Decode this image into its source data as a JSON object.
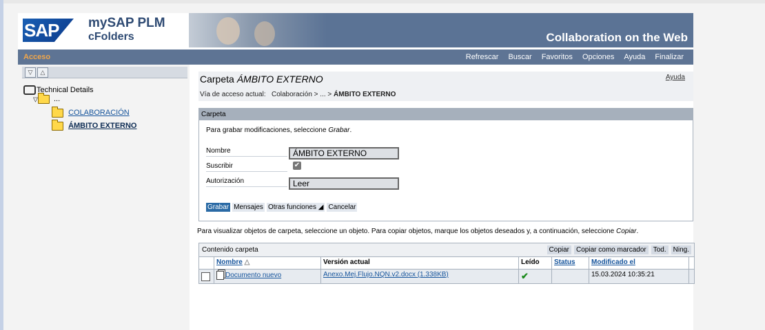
{
  "header": {
    "sap_logo": "SAP",
    "product_line1": "mySAP PLM",
    "product_line2": "cFolders",
    "tagline": "Collaboration on the Web"
  },
  "nav": {
    "left_label": "Acceso",
    "links": [
      "Refrescar",
      "Buscar",
      "Favoritos",
      "Opciones",
      "Ayuda",
      "Finalizar"
    ]
  },
  "tree": {
    "root": "Technical Details",
    "parent": "...",
    "item1": "COLABORACIÓN",
    "item2": "ÁMBITO EXTERNO"
  },
  "folder_page": {
    "title_prefix": "Carpeta ",
    "title_name": "ÁMBITO EXTERNO",
    "help_link": "Ayuda",
    "breadcrumb_label": "Vía de acceso actual:",
    "breadcrumb_path": "Colaboración > ... >",
    "breadcrumb_current": "ÁMBITO EXTERNO"
  },
  "carpeta_panel": {
    "header": "Carpeta",
    "instruction_prefix": "Para grabar modificaciones, seleccione ",
    "instruction_action": "Grabar",
    "fields": {
      "nombre_label": "Nombre",
      "nombre_value": "ÁMBITO EXTERNO",
      "suscribir_label": "Suscribir",
      "suscribir_checked": true,
      "autorizacion_label": "Autorización",
      "autorizacion_value": "Leer"
    },
    "buttons": [
      "Grabar",
      "Mensajes",
      "Otras funciones ◢",
      "Cancelar"
    ]
  },
  "view_instruction_prefix": "Para visualizar objetos de carpeta, seleccione un objeto. Para copiar objetos, marque los objetos deseados y, a continuación, seleccione ",
  "view_instruction_action": "Copiar",
  "content_table": {
    "title": "Contenido carpeta",
    "actions": [
      "Copiar",
      "Copiar como marcador",
      "Tod.",
      "Ning."
    ],
    "columns": [
      "Nombre",
      "Versión actual",
      "Leído",
      "Status",
      "Modificado el"
    ],
    "rows": [
      {
        "nombre": "Documento nuevo",
        "version": "Anexo.Mej.Flujo.NQN.v2.docx (1.338KB)",
        "leido": "✔",
        "status": "",
        "modificado": "15.03.2024 10:35:21"
      }
    ]
  }
}
